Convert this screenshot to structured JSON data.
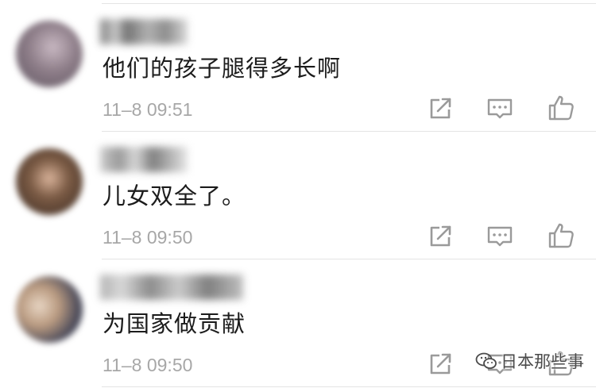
{
  "comments": [
    {
      "text": "他们的孩子腿得多长啊",
      "time": "11–8 09:51"
    },
    {
      "text": "儿女双全了。",
      "time": "11–8 09:50"
    },
    {
      "text": "为国家做贡献",
      "time": "11–8 09:50"
    }
  ],
  "actions": {
    "share_icon": "share-icon",
    "reply_icon": "reply-icon",
    "like_icon": "thumbs-up-icon"
  },
  "watermark": {
    "logo_icon": "wechat-logo-icon",
    "text": "日本那些事"
  },
  "colors": {
    "text": "#1c1c1c",
    "timestamp": "#a7a7a7",
    "icon": "#9a9a9a",
    "divider": "#e4e4e4"
  }
}
